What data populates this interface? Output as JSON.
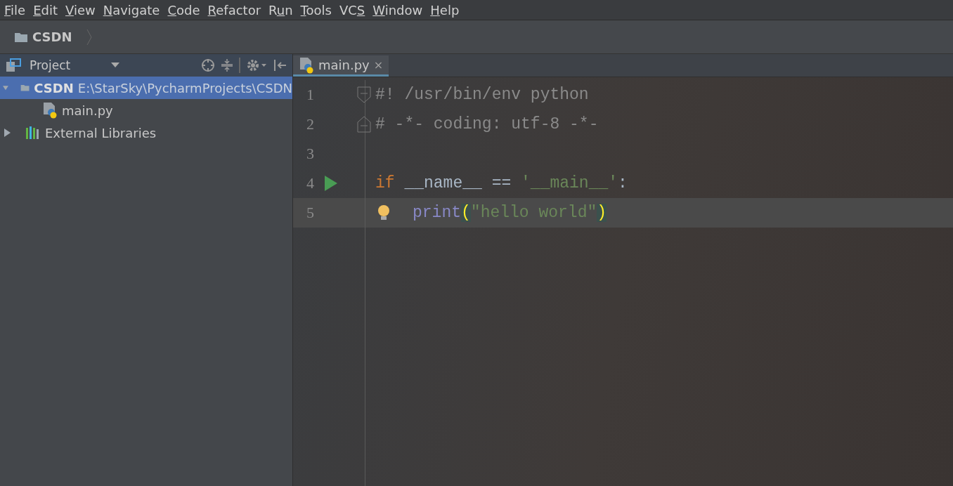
{
  "menu": [
    {
      "parts": [
        {
          "text": "F",
          "underline": true
        },
        {
          "text": "ile",
          "underline": false
        }
      ]
    },
    {
      "parts": [
        {
          "text": "E",
          "underline": true
        },
        {
          "text": "dit",
          "underline": false
        }
      ]
    },
    {
      "parts": [
        {
          "text": "V",
          "underline": true
        },
        {
          "text": "iew",
          "underline": false
        }
      ]
    },
    {
      "parts": [
        {
          "text": "N",
          "underline": true
        },
        {
          "text": "avigate",
          "underline": false
        }
      ]
    },
    {
      "parts": [
        {
          "text": "C",
          "underline": true
        },
        {
          "text": "ode",
          "underline": false
        }
      ]
    },
    {
      "parts": [
        {
          "text": "R",
          "underline": true
        },
        {
          "text": "efactor",
          "underline": false
        }
      ]
    },
    {
      "parts": [
        {
          "text": "R",
          "underline": false
        },
        {
          "text": "u",
          "underline": true
        },
        {
          "text": "n",
          "underline": false
        }
      ]
    },
    {
      "parts": [
        {
          "text": "T",
          "underline": true
        },
        {
          "text": "ools",
          "underline": false
        }
      ]
    },
    {
      "parts": [
        {
          "text": "VC",
          "underline": false
        },
        {
          "text": "S",
          "underline": true
        }
      ]
    },
    {
      "parts": [
        {
          "text": "W",
          "underline": true
        },
        {
          "text": "indow",
          "underline": false
        }
      ]
    },
    {
      "parts": [
        {
          "text": "H",
          "underline": true
        },
        {
          "text": "elp",
          "underline": false
        }
      ]
    }
  ],
  "breadcrumb": {
    "label": "CSDN"
  },
  "project_panel": {
    "title": "Project",
    "tree": [
      {
        "label": "CSDN",
        "path": "E:\\StarSky\\PycharmProjects\\CSDN",
        "kind": "folder",
        "expanded": true,
        "selected": true,
        "children": [
          {
            "label": "main.py",
            "kind": "python",
            "selected": false
          }
        ]
      },
      {
        "label": "External Libraries",
        "kind": "libraries",
        "expanded": false,
        "selected": false
      }
    ]
  },
  "editor": {
    "tabs": [
      {
        "label": "main.py",
        "close": "×",
        "selected": true
      }
    ],
    "lines": [
      {
        "number": "1",
        "fold_start": true,
        "current": false,
        "tokens": [
          {
            "text": "#! /usr/bin/env python",
            "kind": "comment"
          }
        ]
      },
      {
        "number": "2",
        "fold_end": true,
        "current": false,
        "tokens": [
          {
            "text": "# -*- coding: utf-8 -*-",
            "kind": "comment"
          }
        ]
      },
      {
        "number": "3",
        "current": false
      },
      {
        "number": "4",
        "run_marker": true,
        "current": false,
        "tokens": [
          {
            "text": "if",
            "kind": "keyword"
          },
          {
            "text": " __name__ == ",
            "kind": "plain"
          },
          {
            "text": "'__main__'",
            "kind": "string"
          },
          {
            "text": ":",
            "kind": "plain"
          }
        ]
      },
      {
        "number": "5",
        "bulb": true,
        "indented": true,
        "current": true,
        "tokens": [
          {
            "text": "print",
            "kind": "builtin"
          },
          {
            "text": "(",
            "kind": "brace-match"
          },
          {
            "text": "\"hello world\"",
            "kind": "string"
          },
          {
            "text": ")",
            "kind": "brace-match"
          }
        ]
      }
    ]
  }
}
